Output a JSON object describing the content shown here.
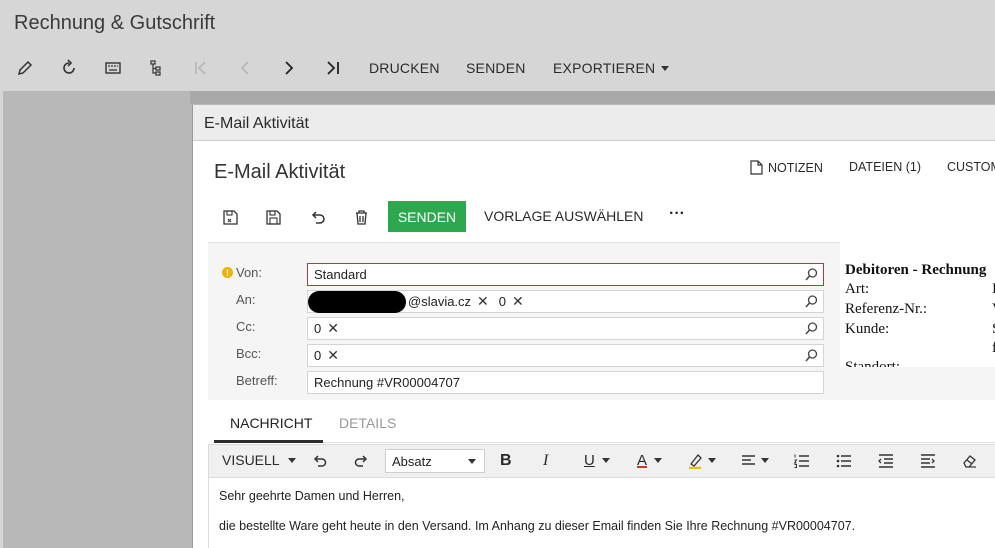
{
  "app": {
    "title": "Rechnung & Gutschrift"
  },
  "main_toolbar": {
    "icons": [
      "edit-icon",
      "refresh-icon",
      "keyboard-icon",
      "tree-icon",
      "first-page-icon",
      "prev-page-icon",
      "next-page-icon",
      "last-page-icon"
    ],
    "print_label": "DRUCKEN",
    "send_label": "SENDEN",
    "export_label": "EXPORTIEREN"
  },
  "dialog": {
    "header_title": "E-Mail Aktivität",
    "form_title": "E-Mail Aktivität",
    "links": {
      "notes": "NOTIZEN",
      "files": "DATEIEN (1)",
      "custom": "CUSTOM"
    },
    "actions": {
      "icons": [
        "save-close-icon",
        "save-icon",
        "undo-icon",
        "delete-icon"
      ],
      "send": "SENDEN",
      "template": "VORLAGE AUSWÄHLEN",
      "more": "···"
    },
    "fields": {
      "from": {
        "label": "Von:",
        "value": "Standard"
      },
      "to": {
        "label": "An:",
        "email_suffix": "@slavia.cz",
        "chip2": "0"
      },
      "cc": {
        "label": "Cc:",
        "chip": "0"
      },
      "bcc": {
        "label": "Bcc:",
        "chip": "0"
      },
      "subject": {
        "label": "Betreff:",
        "value": "Rechnung #VR00004707"
      }
    },
    "info": {
      "heading": "Debitoren - Rechnung",
      "rows": [
        {
          "label": "Art:",
          "value": "I"
        },
        {
          "label": "Referenz-Nr.:",
          "value": "V"
        },
        {
          "label": "Kunde:",
          "value": "S"
        },
        {
          "label": "",
          "value": "f"
        },
        {
          "label": "Standort:",
          "value": ""
        }
      ]
    },
    "tabs": {
      "message": "NACHRICHT",
      "details": "DETAILS"
    },
    "editor": {
      "mode": "VISUELL",
      "format": "Absatz",
      "bold": "B",
      "italic": "I",
      "underline": "U",
      "font_color": "A",
      "greeting": "Sehr geehrte Damen und Herren,",
      "body": "die bestellte Ware geht heute in den Versand. Im Anhang zu dieser Email finden Sie Ihre Rechnung #VR00004707."
    }
  },
  "colors": {
    "send_button": "#2ea84f",
    "error_border": "#b33a3a",
    "warning": "#f0b400",
    "font_color_accent": "#c0392b",
    "highlight_accent": "#e6c300"
  }
}
